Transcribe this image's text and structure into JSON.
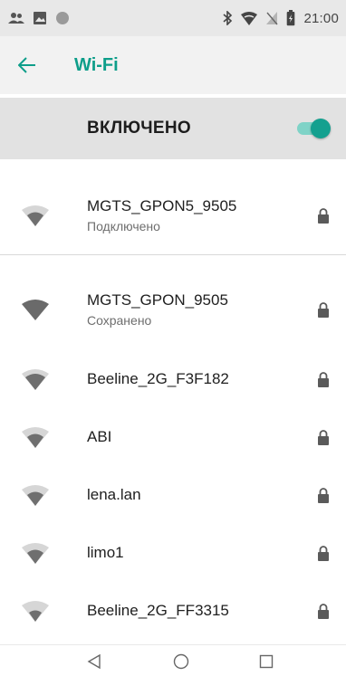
{
  "status_bar": {
    "time": "21:00",
    "left_icons": [
      "contacts-icon",
      "image-icon",
      "circle-icon"
    ],
    "right_icons": [
      "bluetooth-icon",
      "wifi-status-icon",
      "no-sim-icon",
      "battery-icon"
    ]
  },
  "app_bar": {
    "title": "Wi-Fi",
    "back_icon": "arrow-back-icon",
    "accent_color": "#0e9e8a"
  },
  "master_switch": {
    "label": "ВКЛЮЧЕНО",
    "on": true,
    "color": "#14a08f"
  },
  "networks": [
    {
      "ssid": "MGTS_GPON5_9505",
      "status": "Подключено",
      "secured": true
    },
    {
      "ssid": "MGTS_GPON_9505",
      "status": "Сохранено",
      "secured": true
    },
    {
      "ssid": "Beeline_2G_F3F182",
      "status": "",
      "secured": true
    },
    {
      "ssid": "ABI",
      "status": "",
      "secured": true
    },
    {
      "ssid": "lena.lan",
      "status": "",
      "secured": true
    },
    {
      "ssid": "limo1",
      "status": "",
      "secured": true
    },
    {
      "ssid": "Beeline_2G_FF3315",
      "status": "",
      "secured": true
    }
  ],
  "nav_bar": {
    "buttons": [
      "back-triangle-icon",
      "home-circle-icon",
      "recents-square-icon"
    ]
  }
}
